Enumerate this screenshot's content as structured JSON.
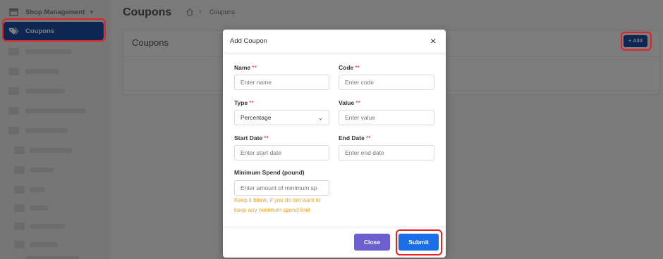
{
  "sidebar": {
    "shop_management": "Shop Management",
    "coupons": "Coupons"
  },
  "header": {
    "title": "Coupons",
    "breadcrumb_current": "Coupons"
  },
  "card": {
    "title": "Coupons",
    "add_button": "Add",
    "add_icon": "+"
  },
  "modal": {
    "title": "Add Coupon",
    "close_icon": "×",
    "required_mark": "**",
    "fields": {
      "name": {
        "label": "Name",
        "placeholder": "Enter name"
      },
      "code": {
        "label": "Code",
        "placeholder": "Enter code"
      },
      "type": {
        "label": "Type",
        "value": "Percentage"
      },
      "value": {
        "label": "Value",
        "placeholder": "Enter value"
      },
      "start_date": {
        "label": "Start Date",
        "placeholder": "Enter start date"
      },
      "end_date": {
        "label": "End Date",
        "placeholder": "Enter end date"
      },
      "min_spend": {
        "label": "Minimum Spend (pound)",
        "placeholder": "Enter amount of minimum sp"
      }
    },
    "hint_line1": "Keep it blank, if you do not want to",
    "hint_line2": "keep any minimum spend limit",
    "close_button": "Close",
    "submit_button": "Submit"
  },
  "colors": {
    "primary": "#1b4fa5",
    "submit": "#1a6fe8",
    "close": "#6c5fcf",
    "required": "#e52125",
    "hint": "#f0a12b",
    "highlight": "#e52125"
  }
}
